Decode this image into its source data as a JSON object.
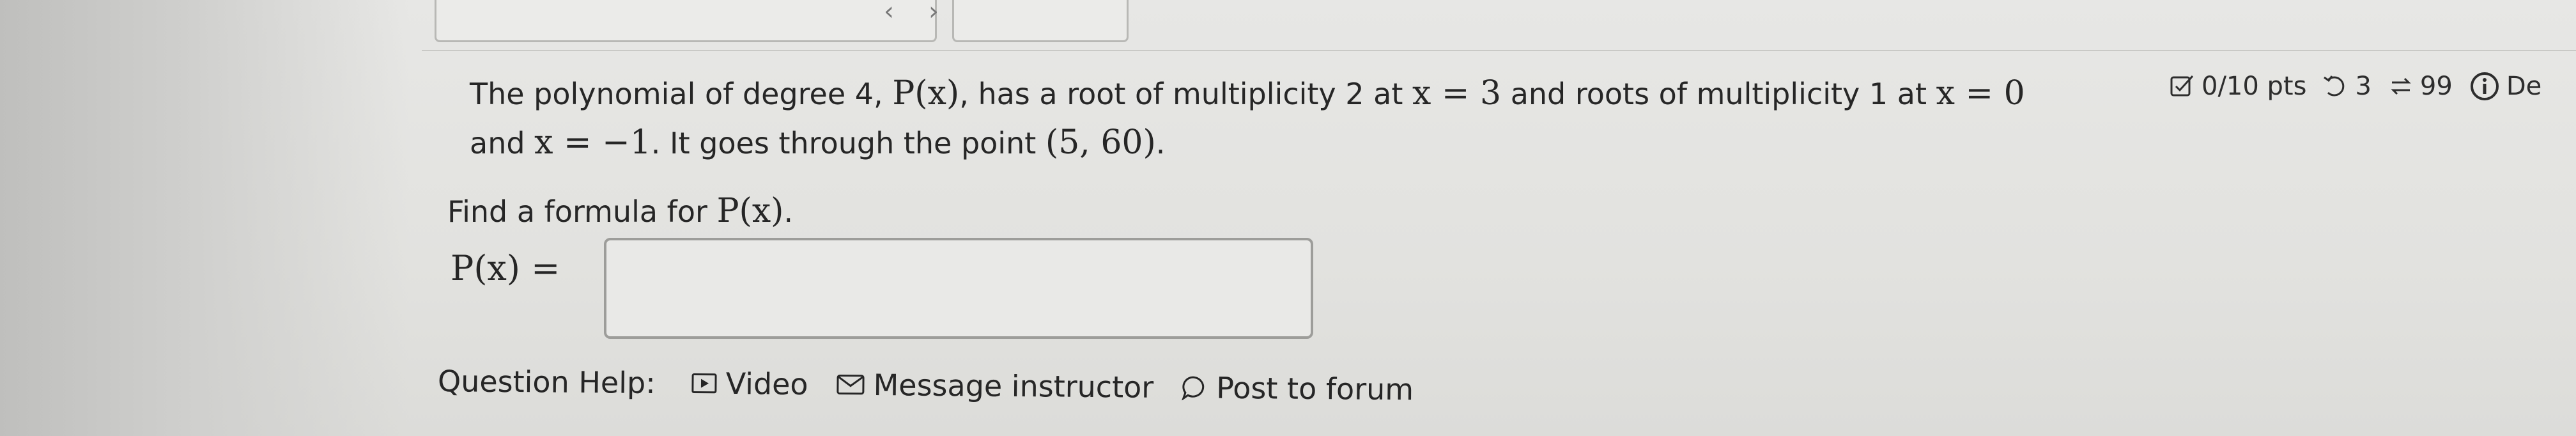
{
  "status": {
    "score": "0/10 pts",
    "retries": "3",
    "attempts": "99",
    "details_truncated": "De"
  },
  "question": {
    "intro": "The polynomial of degree 4,",
    "func": "P(x)",
    "mid1": ", has a root of multiplicity 2 at",
    "eq1": "x = 3",
    "mid2": "and roots of multiplicity 1 at",
    "eq2": "x = 0",
    "mid3": "and",
    "eq3": "x = −1",
    "mid4": ". It goes through the point",
    "point": "(5, 60)",
    "end": "."
  },
  "prompt": {
    "text": "Find a formula for",
    "func": "P(x)",
    "end": "."
  },
  "answer": {
    "label": "P(x) =",
    "value": "",
    "placeholder": ""
  },
  "help": {
    "label": "Question Help:",
    "video": "Video",
    "message": "Message instructor",
    "forum": "Post to forum"
  },
  "colors": {
    "background": "#e2e2df",
    "text": "#262626",
    "input_border": "#9d9d9a",
    "info_icon": "#2d2d2d"
  }
}
